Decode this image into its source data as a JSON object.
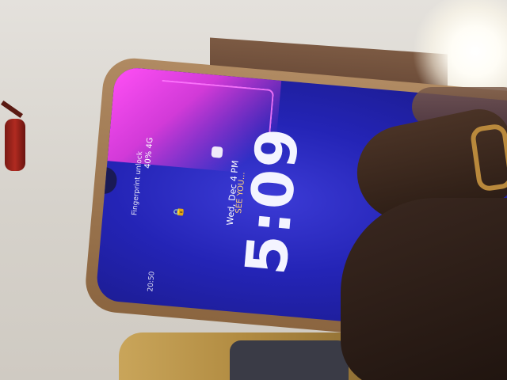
{
  "lock_screen": {
    "time": "5:09",
    "date": "Wed, Dec 4 PM",
    "caption": "SEE YOU...",
    "status_text": "40% 4G",
    "notification": "Fingerprint unlock",
    "bottom_text": "20:50"
  },
  "colors": {
    "screen_blue": "#2424b6",
    "accent_magenta": "#ff4ff5",
    "circuit_teal": "#37e0c0",
    "phone_frame": "#a07a52"
  }
}
